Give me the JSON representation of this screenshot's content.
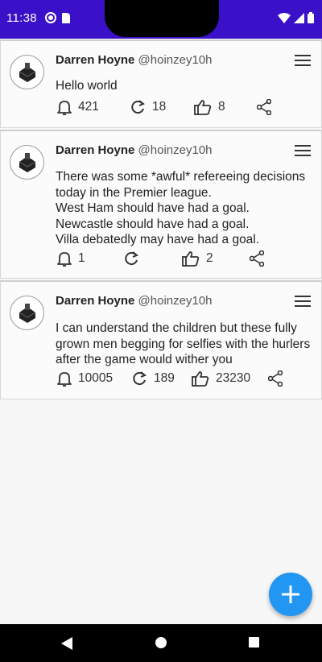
{
  "status_bar": {
    "time": "11:38",
    "background": "#3a10c8"
  },
  "posts": [
    {
      "author": "Darren Hoyne",
      "handle": "@hoinzey",
      "time": "10h",
      "body": "Hello world",
      "notifications": "421",
      "retweets": "18",
      "likes": "8"
    },
    {
      "author": "Darren Hoyne",
      "handle": "@hoinzey",
      "time": "10h",
      "body": "There was some *awful* refereeing decisions today in the Premier league.\nWest Ham should have had a goal.\nNewcastle should have had a goal.\nVilla debatedly may have had a goal.",
      "notifications": "1",
      "retweets": "",
      "likes": "2"
    },
    {
      "author": "Darren Hoyne",
      "handle": "@hoinzey",
      "time": "10h",
      "body": "I can understand the children but these fully grown men begging for selfies with the hurlers after the game would wither you",
      "notifications": "10005",
      "retweets": "189",
      "likes": "23230"
    }
  ],
  "fab": {
    "icon": "plus-icon",
    "color": "#2196f3"
  },
  "nav_bar": {
    "icons": [
      "back-icon",
      "home-icon",
      "recents-icon"
    ]
  }
}
